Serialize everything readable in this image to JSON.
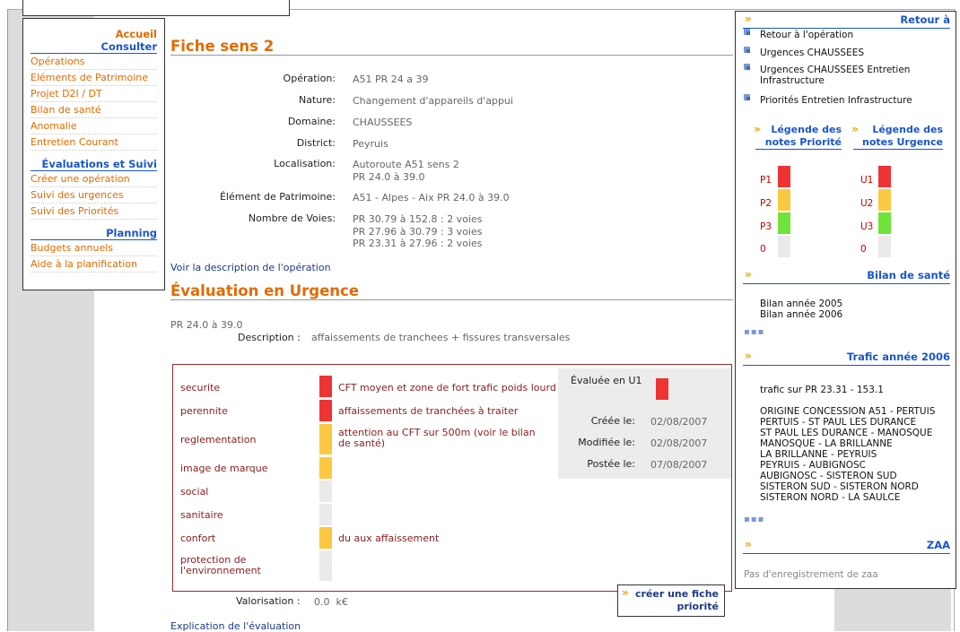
{
  "nav": {
    "accueil": "Accueil",
    "consulter": "Consulter",
    "consulter_items": [
      "Opérations",
      "Eléments de Patrimoine",
      "Projet D2I / DT",
      "Bilan de santé",
      "Anomalie",
      "Entretien Courant"
    ],
    "evaluations": "Évaluations et Suivi",
    "evaluations_items": [
      "Créer une opération",
      "Suivi des urgences",
      "Suivi des Priorités"
    ],
    "planning": "Planning",
    "planning_items": [
      "Budgets annuels",
      "Aide à la planification"
    ]
  },
  "fiche": {
    "title": "Fiche sens 2",
    "rows": [
      {
        "label": "Opération:",
        "value": "A51 PR 24 a 39"
      },
      {
        "label": "Nature:",
        "value": "Changement d'appareils d'appui"
      },
      {
        "label": "Domaine:",
        "value": "CHAUSSEES"
      },
      {
        "label": "District:",
        "value": "Peyruis"
      },
      {
        "label": "Localisation:",
        "value": "Autoroute A51 sens 2\nPR 24.0 à 39.0"
      },
      {
        "label": "Élément de Patrimoine:",
        "value": "A51 - Alpes - Aix PR 24.0 à 39.0"
      },
      {
        "label": "Nombre de Voies:",
        "value": "PR 30.79 à 152.8 : 2 voies\nPR 27.96 à 30.79 : 3 voies\nPR 23.31 à 27.96 : 2 voies"
      }
    ],
    "voir_link": "Voir la description de l'opération"
  },
  "evaluation": {
    "title": "Évaluation en Urgence",
    "pr": "PR 24.0 à 39.0",
    "description_label": "Description :",
    "description_value": "affaissements de tranchees + fissures transversales",
    "criteria": [
      {
        "name": "securite",
        "level": "red",
        "comment": "CFT moyen et zone de fort trafic poids lourd"
      },
      {
        "name": "perennite",
        "level": "red",
        "comment": "affaissements de tranchées à traiter"
      },
      {
        "name": "reglementation",
        "level": "yellow",
        "comment": "attention au CFT sur 500m (voir le bilan de santé)"
      },
      {
        "name": "image de marque",
        "level": "yellow",
        "comment": ""
      },
      {
        "name": "social",
        "level": "empty",
        "comment": ""
      },
      {
        "name": "sanitaire",
        "level": "empty",
        "comment": ""
      },
      {
        "name": "confort",
        "level": "yellow",
        "comment": "du aux affaissement"
      },
      {
        "name": "protection de l'environnement",
        "level": "empty",
        "comment": ""
      }
    ],
    "evaluee_label": "Évaluée en U1",
    "dates": [
      {
        "label": "Créée le:",
        "value": "02/08/2007"
      },
      {
        "label": "Modifiée le:",
        "value": "02/08/2007"
      },
      {
        "label": "Postée le:",
        "value": "07/08/2007"
      }
    ],
    "valorisation_label": "Valorisation :",
    "valorisation_value": "0.0  k€",
    "creer_fiche": "créer une fiche priorité",
    "explication_link": "Explication de l'évaluation"
  },
  "right": {
    "retour_title": "Retour à",
    "retour_items": [
      "Retour à l'opération",
      "Urgences CHAUSSEES",
      "Urgences CHAUSSEES Entretien Infrastructure",
      "Priorités Entretien Infrastructure"
    ],
    "legende_priorite": "Légende des notes Priorité",
    "legende_urgence": "Légende des notes Urgence",
    "priorite_levels": [
      "P1",
      "P2",
      "P3",
      "0"
    ],
    "urgence_levels": [
      "U1",
      "U2",
      "U3",
      "0"
    ],
    "bilan_title": "Bilan de santé",
    "bilan_items": [
      "Bilan année 2005",
      "Bilan année 2006"
    ],
    "trafic_title": "Trafic année 2006",
    "trafic_sur": "trafic sur PR 23.31 - 153.1",
    "trafic_items": [
      "ORIGINE CONCESSION A51 - PERTUIS",
      "PERTUIS - ST PAUL LES DURANCE",
      "ST PAUL LES DURANCE - MANOSQUE",
      "MANOSQUE - LA BRILLANNE",
      "LA BRILLANNE - PEYRUIS",
      "PEYRUIS - AUBIGNOSC",
      "AUBIGNOSC - SISTERON SUD",
      "SISTERON SUD - SISTERON NORD",
      "SISTERON NORD - LA SAULCE"
    ],
    "zaa_title": "ZAA",
    "zaa_text": "Pas d'enregistrement de zaa",
    "more": "▪▪▪"
  },
  "colors": {
    "orange": "#e36a00",
    "blue": "#1a56c8",
    "red": "#ee3333",
    "yellow": "#fbc841",
    "green": "#6fe33a",
    "empty": "#eaeaea"
  }
}
